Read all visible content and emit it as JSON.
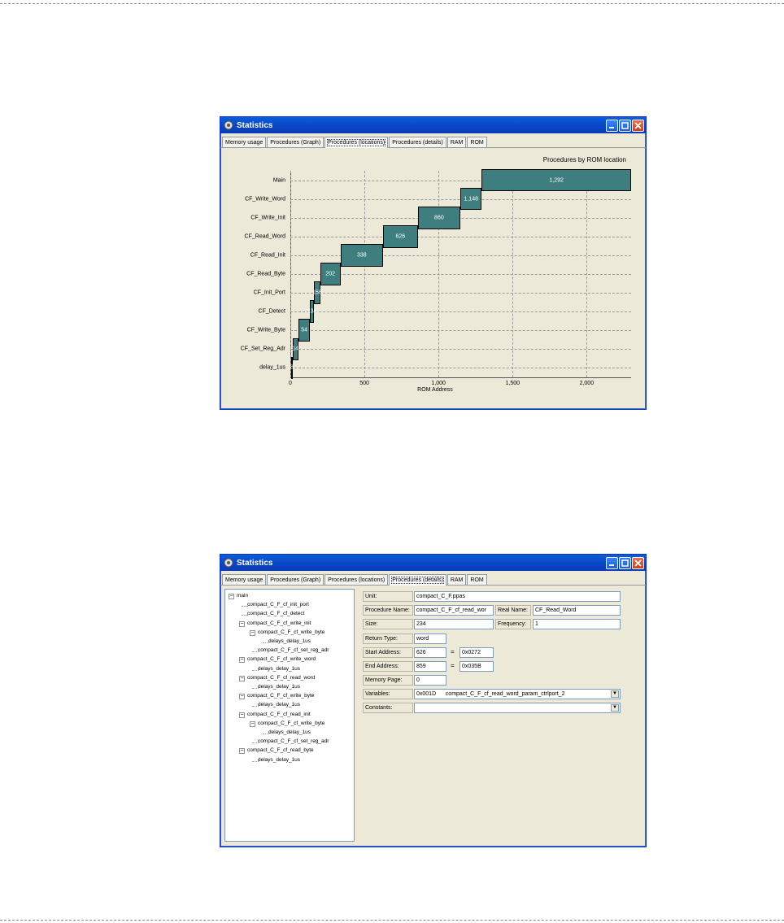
{
  "window1": {
    "title": "Statistics",
    "tabs": [
      "Memory usage",
      "Procedures (Graph)",
      "Procedures (locations)",
      "Procedures (details)",
      "RAM",
      "ROM"
    ],
    "active_tab": "Procedures (locations)"
  },
  "window2": {
    "title": "Statistics",
    "tabs": [
      "Memory usage",
      "Procedures (Graph)",
      "Procedures (locations)",
      "Procedures (details)",
      "RAM",
      "ROM"
    ],
    "active_tab": "Procedures (details)"
  },
  "chart_data": {
    "type": "bar",
    "title": "Procedures by ROM location",
    "xlabel": "ROM Address",
    "ylabel": "",
    "xlim": [
      0,
      2300
    ],
    "xticks": [
      "0",
      "500",
      "1,000",
      "1,500",
      "2,000"
    ],
    "xtick_values": [
      0,
      500,
      1000,
      1500,
      2000
    ],
    "categories": [
      "Main",
      "CF_Write_Word",
      "CF_Write_Init",
      "CF_Read_Word",
      "CF_Read_Init",
      "CF_Read_Byte",
      "CF_Init_Port",
      "CF_Detect",
      "CF_Write_Byte",
      "CF_Set_Reg_Adr",
      "delay_1us"
    ],
    "start": [
      1292,
      1148,
      860,
      626,
      338,
      202,
      158,
      134,
      54,
      14,
      8
    ],
    "end": [
      2300,
      1292,
      1148,
      860,
      626,
      338,
      202,
      158,
      134,
      54,
      14
    ],
    "labels": [
      "1,292",
      "1,148",
      "860",
      "626",
      "338",
      "202",
      "158",
      "134",
      "54",
      "14",
      "8"
    ],
    "grid": true,
    "color": "#3f7e7e"
  },
  "details": {
    "tree": [
      {
        "label": "main",
        "level": 0,
        "expander": "−"
      },
      {
        "label": "compact_C_F_cf_init_port",
        "level": 1
      },
      {
        "label": "compact_C_F_cf_detect",
        "level": 1
      },
      {
        "label": "compact_C_F_cf_write_init",
        "level": 1,
        "expander": "−"
      },
      {
        "label": "compact_C_F_cf_write_byte",
        "level": 2,
        "expander": "−"
      },
      {
        "label": "delays_delay_1us",
        "level": 3
      },
      {
        "label": "compact_C_F_cf_set_reg_adr",
        "level": 2
      },
      {
        "label": "compact_C_F_cf_write_word",
        "level": 1,
        "expander": "−"
      },
      {
        "label": "delays_delay_1us",
        "level": 2
      },
      {
        "label": "compact_C_F_cf_read_word",
        "level": 1,
        "expander": "−"
      },
      {
        "label": "delays_delay_1us",
        "level": 2
      },
      {
        "label": "compact_C_F_cf_write_byte",
        "level": 1,
        "expander": "−"
      },
      {
        "label": "delays_delay_1us",
        "level": 2
      },
      {
        "label": "compact_C_F_cf_read_init",
        "level": 1,
        "expander": "−"
      },
      {
        "label": "compact_C_F_cf_write_byte",
        "level": 2,
        "expander": "−"
      },
      {
        "label": "delays_delay_1us",
        "level": 3
      },
      {
        "label": "compact_C_F_cf_set_reg_adr",
        "level": 2
      },
      {
        "label": "compact_C_F_cf_read_byte",
        "level": 1,
        "expander": "−"
      },
      {
        "label": "delays_delay_1us",
        "level": 2
      }
    ],
    "unit_label": "Unit:",
    "unit": "compact_C_F.ppas",
    "proc_name_label": "Procedure Name:",
    "proc_name": "compact_C_F_cf_read_wor",
    "real_name_label": "Real Name:",
    "real_name": "CF_Read_Word",
    "size_label": "Size:",
    "size": "234",
    "frequency_label": "Frequency:",
    "frequency": "1",
    "return_type_label": "Return Type:",
    "return_type": "word",
    "start_label": "Start Address:",
    "start_dec": "626",
    "start_hex": "0x0272",
    "end_label": "End Address:",
    "end_dec": "859",
    "end_hex": "0x035B",
    "eq": "=",
    "mem_page_label": "Memory Page:",
    "mem_page": "0",
    "variables_label": "Variables:",
    "variables": "0x001D      compact_C_F_cf_read_word_param_ctrlport_2",
    "constants_label": "Constants:",
    "constants": ""
  }
}
